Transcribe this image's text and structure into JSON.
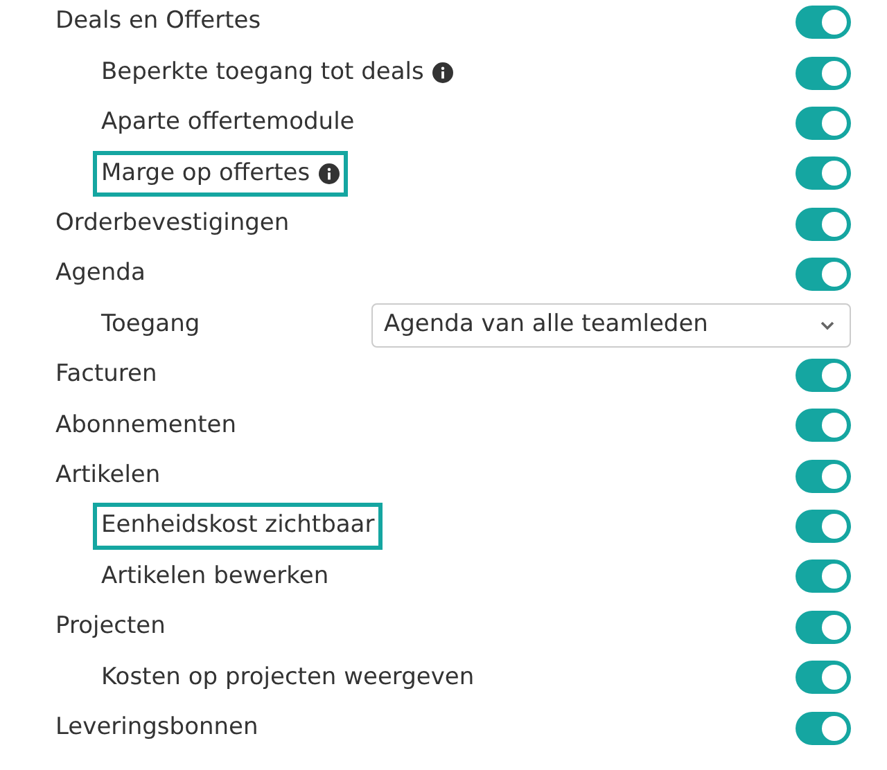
{
  "settings": [
    {
      "kind": "toggle",
      "label": "Deals en Offertes",
      "on": true,
      "highlighted": false,
      "info_icon": false,
      "children": [
        {
          "kind": "toggle",
          "label": "Beperkte toegang tot deals",
          "on": true,
          "highlighted": false,
          "info_icon": true
        },
        {
          "kind": "toggle",
          "label": "Aparte offertemodule",
          "on": true,
          "highlighted": false,
          "info_icon": false
        },
        {
          "kind": "toggle",
          "label": "Marge op offertes",
          "on": true,
          "highlighted": true,
          "info_icon": true
        }
      ]
    },
    {
      "kind": "toggle",
      "label": "Orderbevestigingen",
      "on": true,
      "highlighted": false,
      "info_icon": false
    },
    {
      "kind": "toggle",
      "label": "Agenda",
      "on": true,
      "highlighted": false,
      "info_icon": false,
      "children": [
        {
          "kind": "select",
          "label": "Toegang",
          "value": "Agenda van alle teamleden",
          "highlighted": false,
          "info_icon": false
        }
      ]
    },
    {
      "kind": "toggle",
      "label": "Facturen",
      "on": true,
      "highlighted": false,
      "info_icon": false
    },
    {
      "kind": "toggle",
      "label": "Abonnementen",
      "on": true,
      "highlighted": false,
      "info_icon": false
    },
    {
      "kind": "toggle",
      "label": "Artikelen",
      "on": true,
      "highlighted": false,
      "info_icon": false,
      "children": [
        {
          "kind": "toggle",
          "label": "Eenheidskost zichtbaar",
          "on": true,
          "highlighted": true,
          "info_icon": false
        },
        {
          "kind": "toggle",
          "label": "Artikelen bewerken",
          "on": true,
          "highlighted": false,
          "info_icon": false
        }
      ]
    },
    {
      "kind": "toggle",
      "label": "Projecten",
      "on": true,
      "highlighted": false,
      "info_icon": false,
      "children": [
        {
          "kind": "toggle",
          "label": "Kosten op projecten weergeven",
          "on": true,
          "highlighted": false,
          "info_icon": false
        }
      ]
    },
    {
      "kind": "toggle",
      "label": "Leveringsbonnen",
      "on": true,
      "highlighted": false,
      "info_icon": false
    }
  ]
}
